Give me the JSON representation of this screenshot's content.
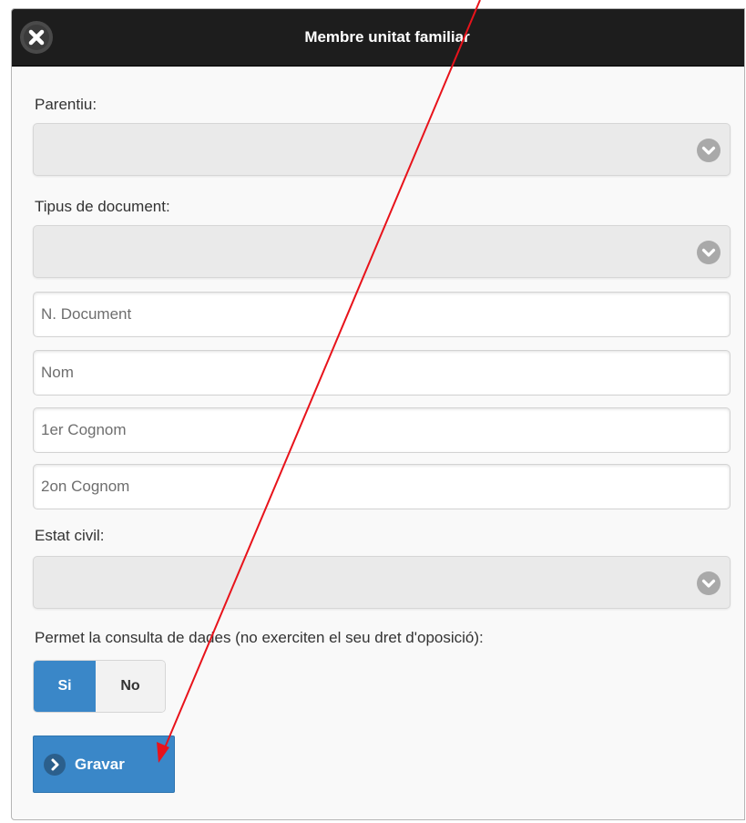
{
  "dialog": {
    "title": "Membre unitat familiar",
    "close_icon": "close-icon"
  },
  "form": {
    "parentiu_label": "Parentiu:",
    "parentiu_value": "",
    "tipus_document_label": "Tipus de document:",
    "tipus_document_value": "",
    "num_document": {
      "placeholder": "N. Document",
      "value": ""
    },
    "nom": {
      "placeholder": "Nom",
      "value": ""
    },
    "cognom1": {
      "placeholder": "1er Cognom",
      "value": ""
    },
    "cognom2": {
      "placeholder": "2on Cognom",
      "value": ""
    },
    "estat_civil_label": "Estat civil:",
    "estat_civil_value": "",
    "consulta_label": "Permet la consulta de dades (no exerciten el seu dret d'oposició):",
    "consulta_options": [
      "Si",
      "No"
    ],
    "consulta_selected": "Si"
  },
  "actions": {
    "save_label": "Gravar",
    "save_icon": "chevron-right-icon"
  },
  "colors": {
    "header_bg": "#1d1d1d",
    "accent": "#3a87c8",
    "annotation_arrow": "#e8131b"
  }
}
